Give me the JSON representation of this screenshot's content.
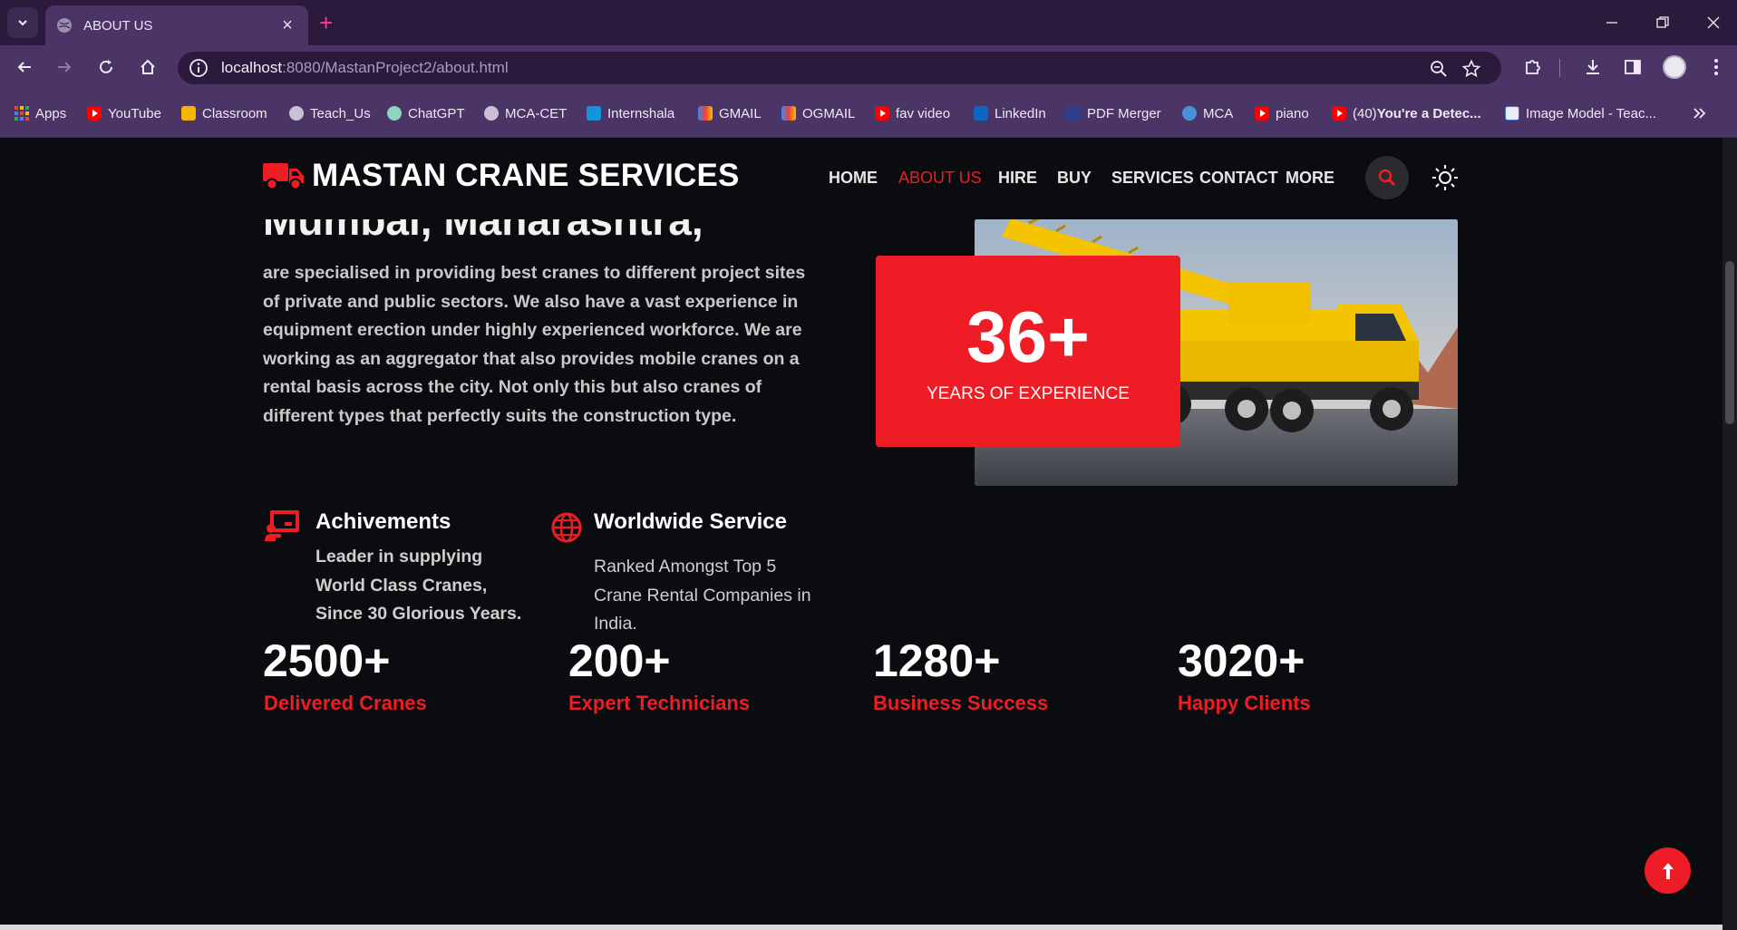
{
  "browser": {
    "tab_title": "ABOUT US",
    "url_host": "localhost",
    "url_path": ":8080/MastanProject2/about.html",
    "bookmarks": [
      {
        "label": "Apps",
        "icon": "apps-grid-icon"
      },
      {
        "label": "YouTube",
        "icon": "youtube-icon"
      },
      {
        "label": "Classroom",
        "icon": "classroom-icon"
      },
      {
        "label": "Teach_Us",
        "icon": "globe-icon"
      },
      {
        "label": "ChatGPT",
        "icon": "chatgpt-icon"
      },
      {
        "label": "MCA-CET",
        "icon": "globe-icon"
      },
      {
        "label": "Internshala",
        "icon": "internshala-icon"
      },
      {
        "label": "GMAIL",
        "icon": "gmail-icon"
      },
      {
        "label": "OGMAIL",
        "icon": "gmail-icon"
      },
      {
        "label": "fav video",
        "icon": "youtube-icon"
      },
      {
        "label": "LinkedIn",
        "icon": "linkedin-icon"
      },
      {
        "label": "PDF Merger",
        "icon": "pdf-icon"
      },
      {
        "label": "MCA",
        "icon": "mca-icon"
      },
      {
        "label": "piano",
        "icon": "youtube-icon"
      },
      {
        "label_prefix": "(40) ",
        "label_bold": "You're a Detec...",
        "icon": "youtube-icon"
      },
      {
        "label": "Image Model - Teac...",
        "icon": "im-icon"
      }
    ]
  },
  "site": {
    "brand": "MASTAN CRANE SERVICES",
    "nav": [
      "HOME",
      "ABOUT US",
      "HIRE",
      "BUY",
      "SERVICES",
      "CONTACT",
      "MORE"
    ],
    "active_nav": "ABOUT US",
    "accent": "#ee1c25"
  },
  "about": {
    "headline": "Mumbai, Maharashtra,",
    "text": "are specialised in providing best cranes to different project sites of private and public sectors. We also have a vast experience in equipment erection under highly experienced workforce. We are working as an aggregator that also provides mobile cranes on a rental basis across the city. Not only this but also cranes of different types that perfectly suits the construction type.",
    "experience_number": "36+",
    "experience_label": "YEARS OF EXPERIENCE"
  },
  "features": [
    {
      "title": "Achivements",
      "desc": "Leader in supplying World Class Cranes, Since 30 Glorious Years.",
      "icon": "presentation-icon"
    },
    {
      "title": "Worldwide Service",
      "desc": "Ranked Amongst Top 5 Crane Rental Companies in India.",
      "icon": "globe-icon"
    }
  ],
  "stats": [
    {
      "number": "2500+",
      "label": "Delivered Cranes"
    },
    {
      "number": "200+",
      "label": "Expert Technicians"
    },
    {
      "number": "1280+",
      "label": "Business Success"
    },
    {
      "number": "3020+",
      "label": "Happy Clients"
    }
  ]
}
